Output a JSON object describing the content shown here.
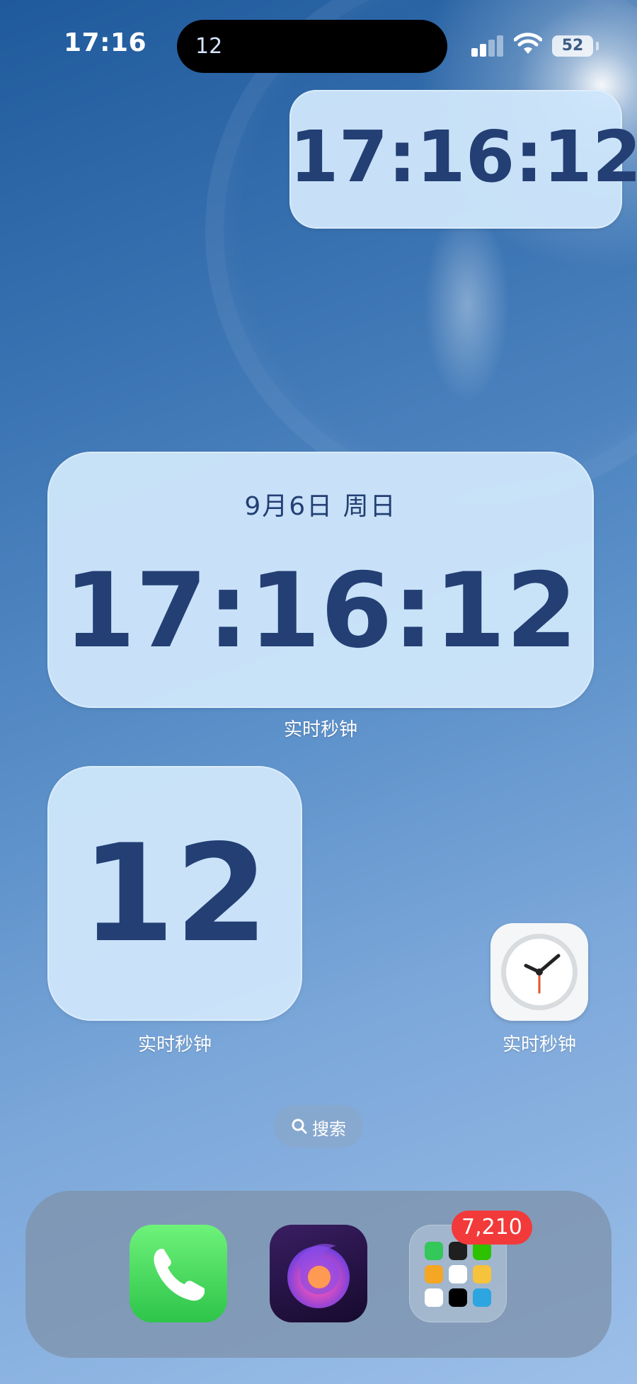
{
  "status_bar": {
    "time": "17:16",
    "island_text": "12",
    "battery": "52"
  },
  "widgets": {
    "small": {
      "time": "17:16:12"
    },
    "large": {
      "date": "9月6日 周日",
      "time": "17:16:12",
      "label": "实时秒钟"
    },
    "square": {
      "seconds": "12",
      "label": "实时秒钟"
    }
  },
  "apps": {
    "clock_app": {
      "label": "实时秒钟",
      "icon": "analog-clock-icon"
    }
  },
  "search": {
    "label": "搜索",
    "icon": "search-icon"
  },
  "dock": {
    "phone": {
      "icon": "phone-icon",
      "color": "#34c759"
    },
    "firefox": {
      "icon": "firefox-icon"
    },
    "folder": {
      "badge": "7,210",
      "badge_color": "#f23a3a"
    }
  }
}
